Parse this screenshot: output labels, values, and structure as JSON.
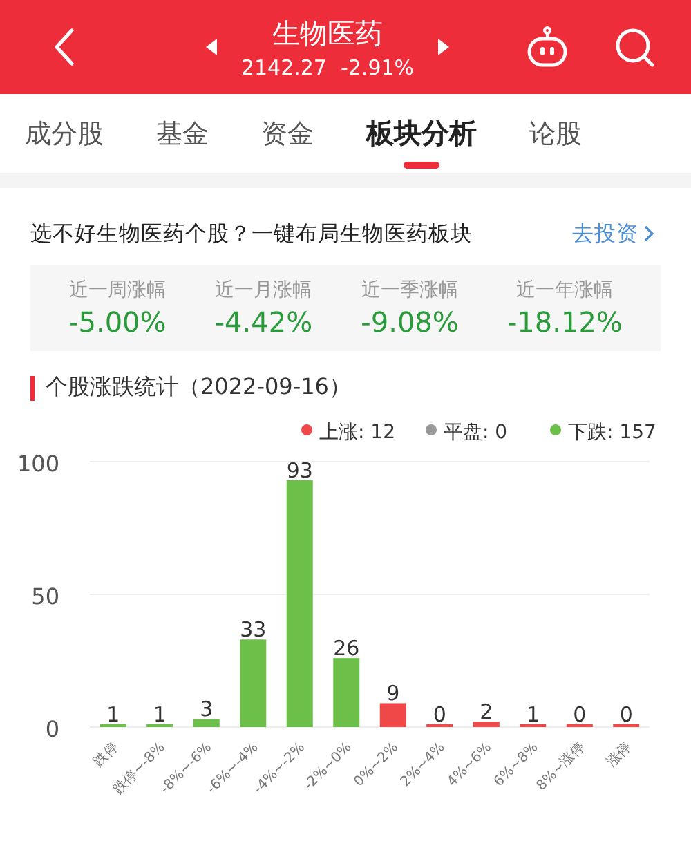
{
  "header": {
    "title": "生物医药",
    "price": "2142.27",
    "change": "-2.91%"
  },
  "tabs": [
    {
      "label": "成分股",
      "selected": false
    },
    {
      "label": "基金",
      "selected": false
    },
    {
      "label": "资金",
      "selected": false
    },
    {
      "label": "板块分析",
      "selected": true
    },
    {
      "label": "论股",
      "selected": false
    }
  ],
  "promo": {
    "text": "选不好生物医药个股？一键布局生物医药板块",
    "link": "去投资"
  },
  "returns": [
    {
      "label": "近一周涨幅",
      "value": "-5.00%"
    },
    {
      "label": "近一月涨幅",
      "value": "-4.42%"
    },
    {
      "label": "近一季涨幅",
      "value": "-9.08%"
    },
    {
      "label": "近一年涨幅",
      "value": "-18.12%"
    }
  ],
  "stats": {
    "title": "个股涨跌统计（2022-09-16）",
    "legend": [
      {
        "label": "上涨: 12",
        "color": "#f04848"
      },
      {
        "label": "平盘: 0",
        "color": "#999999"
      },
      {
        "label": "下跌: 157",
        "color": "#6cc04a"
      }
    ],
    "chart_data": {
      "type": "bar",
      "data_labels": true,
      "categories": [
        "跌停",
        "跌停~-8%",
        "-8%~-6%",
        "-6%~-4%",
        "-4%~-2%",
        "-2%~0%",
        "0%~2%",
        "2%~4%",
        "4%~6%",
        "6%~8%",
        "8%~涨停",
        "涨停"
      ],
      "series": [
        {
          "color": "#6cc04a",
          "values": [
            1,
            1,
            3,
            33,
            93,
            26,
            null,
            null,
            null,
            null,
            null,
            null
          ]
        },
        {
          "color": "#f04848",
          "values": [
            null,
            null,
            null,
            null,
            null,
            null,
            9,
            0,
            2,
            1,
            0,
            0
          ]
        }
      ],
      "ylim": [
        0,
        100
      ],
      "yticks": [
        0,
        50,
        100
      ]
    }
  }
}
